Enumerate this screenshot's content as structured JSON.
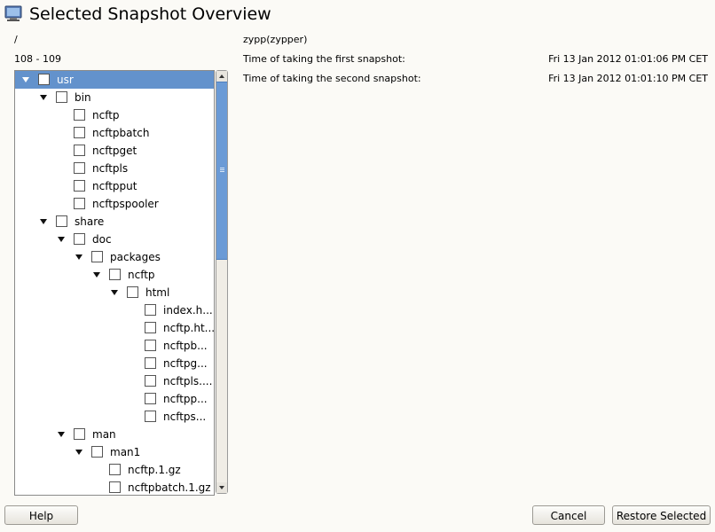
{
  "window": {
    "title": "Selected Snapshot Overview"
  },
  "info": {
    "path": "/",
    "range": "108 - 109",
    "description": "zypp(zypper)",
    "first_label": "Time of taking the first snapshot:",
    "first_time": "Fri 13 Jan 2012 01:01:06 PM CET",
    "second_label": "Time of taking the second snapshot:",
    "second_time": "Fri 13 Jan 2012 01:01:10 PM CET"
  },
  "tree": {
    "items": [
      {
        "label": "usr"
      },
      {
        "label": "bin"
      },
      {
        "label": "ncftp"
      },
      {
        "label": "ncftpbatch"
      },
      {
        "label": "ncftpget"
      },
      {
        "label": "ncftpls"
      },
      {
        "label": "ncftpput"
      },
      {
        "label": "ncftpspooler"
      },
      {
        "label": "share"
      },
      {
        "label": "doc"
      },
      {
        "label": "packages"
      },
      {
        "label": "ncftp"
      },
      {
        "label": "html"
      },
      {
        "label": "index.h..."
      },
      {
        "label": "ncftp.ht..."
      },
      {
        "label": "ncftpb..."
      },
      {
        "label": "ncftpg..."
      },
      {
        "label": "ncftpls...."
      },
      {
        "label": "ncftpp..."
      },
      {
        "label": "ncftps..."
      },
      {
        "label": "man"
      },
      {
        "label": "man1"
      },
      {
        "label": "ncftp.1.gz"
      },
      {
        "label": "ncftpbatch.1.gz"
      }
    ]
  },
  "buttons": {
    "help": "Help",
    "cancel": "Cancel",
    "restore": "Restore Selected"
  },
  "colors": {
    "selection": "#6392cc",
    "scrollbar_thumb": "#6a9ad6",
    "background": "#fbfaf6"
  }
}
